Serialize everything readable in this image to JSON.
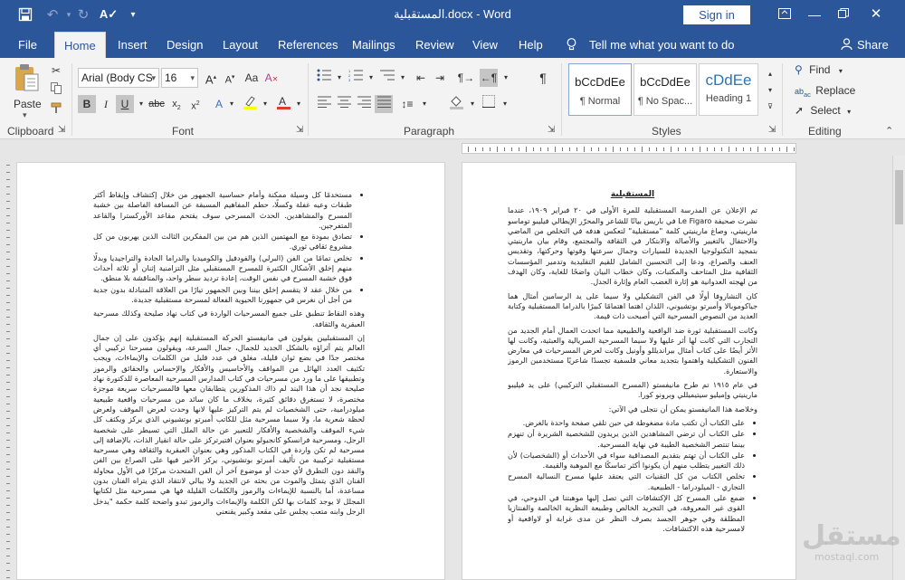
{
  "window": {
    "title": "المستقبلية.docx - Word",
    "sign_in": "Sign in",
    "qat": [
      "save-icon",
      "undo-icon",
      "redo-icon",
      "spelling-icon",
      "customize-icon"
    ]
  },
  "ribbon_tabs": [
    "File",
    "Home",
    "Insert",
    "Design",
    "Layout",
    "References",
    "Mailings",
    "Review",
    "View",
    "Help"
  ],
  "tell_me": "Tell me what you want to do",
  "share": "Share",
  "clipboard": {
    "paste": "Paste",
    "label": "Clipboard"
  },
  "font": {
    "name": "Arial (Body CS",
    "size": "16",
    "label": "Font"
  },
  "paragraph": {
    "label": "Paragraph"
  },
  "styles": {
    "label": "Styles",
    "items": [
      {
        "preview": "bCcDdEe",
        "name": "¶ Normal"
      },
      {
        "preview": "bCcDdEe",
        "name": "¶ No Spac..."
      },
      {
        "preview": "cDdEe",
        "name": "Heading 1"
      }
    ]
  },
  "editing": {
    "label": "Editing",
    "find": "Find",
    "replace": "Replace",
    "select": "Select"
  },
  "document": {
    "right_page": {
      "title": "المستقبلية",
      "paragraphs": [
        "تم الإعلان عن المدرسة المستقبلية للمرة الأولى في ٢٠ فبراير ١٩٠٩، عندما نشرت صحيفة Le Figaro في باريس بيانًا للشاعر والمحرّر الإيطالي فيليبو توماسو مارينيتي، وصاغ مارينيتي كلمة \"مستقبلية\" لتعكس هدفه في التخلص من الماضي والاحتفال بالتغيير والأصالة والابتكار في الثقافة والمجتمع، وقام بيان مارينيتي بتمجيد التكنولوجيا الجديدة للسيارات وجمال سرعتها وقوتها وحركتها، وتقديس العنف والصراع، ودعا إلى التحسين الشامل للقيم التقليدية وتدمير المؤسسات الثقافية مثل المتاحف والمكتبات، وكان خطاب البيان واضحًا للغاية، وكان الهدف من لهجته العدوانية هو إثارة الغضب العام وإثارة الجدل.",
        "كان التشاروفا أولًا في الفن التشكيلي ولا سيما على يد الرسامين أمثال هما جياكوموبالا وأمبرتو بوتشيوني، اللذان اهتما اهتمامًا كبيرًا بالدراما المستقبلية وكتابة العديد من النصوص المسرحية التي أصبحت ذات قيمة.",
        "وكانت المستقبلية ثورة ضد الواقعية والطبيعية مما اتحدت العمال أمام الجديد من التجارب التي كانت لها أثر عليها ولا سيما المسرحية السريالية والعبثية، وكانت لها الأثر أيضًا على كتاب أمثال بيرانديللو وأونيل وكانت لعرض المسرحيات في معارض الفنون التشكيلية واهتموا بتجديد معاني فلسفية تجسدًا شاعريًا مستخدمين الرموز والاستعارة.",
        "في عام ١٩١٥ تم طرح مانيفستو (المسرح المستقبلي التركيبي) على يد فيليبو مارينيتي وإميليو سيتيميللي وبرونو كورا.",
        "وخلاصة هذا المانيفستو يمكن أن نتجلى في الآتي:"
      ],
      "bullets": [
        "على الكتاب أن تكتب مادة مضغوطة في حين تلقي صفحة واحدة بالغرض.",
        "على الكتاب أن ترضي المشاهدين الذين يريدون للشخصية الشريرة أن تنهزم بينما تنتصر الشخصية الطيبة في نهاية المسرحية.",
        "على الكتاب أن تهتم بتقديم المصداقية سواء في الأحداث أو (الشخصيات) لأن ذلك التغيير يتطلب منهم أن يكونوا أكثر تماسكًا مع الموهبة والقيمة.",
        "تخلص الكتاب من كل التقنيات التي يعتقد عليها مسرح النسالية المسرح التجاري - الميلودراما - الطبيعية.",
        "ضمع على المسرح كل الإكتشافات التي تصل إليها موهبتنا في الدوحي، في القوى غير المعروفة، في التجريد الخالص وطبيعة النظرية الخالصة والفنتازيا المطلقة وفي جوهر الجسد بصرف النظر عن مدى غرابة أو لاواقعية أو لامسرحية هذه الاكتشافات."
      ]
    },
    "left_page": {
      "bullets": [
        "مستخدمًا كل وسيلة ممكنة وأمام حساسية الجمهور من خلال إكتشاف وإيقاظ أكثر طبقات وعيه غفلة وكسلًا، حطم المفاهيم المسبقة عن المسافة الفاصلة بين خشبة المسرح والمشاهدين. الحدث المسرحي سوف يقتحم مقاعد الأوركسترا والقاعد المتفرجين.",
        "تصادق بمودة مع المهتمين الذين هم من بين المفكرين الثالث الذين يهربون من كل مشروع ثقافي ثوري.",
        "تخلص تمامًا من الفن (البرلي) والفودفيل والكوميديا والدراما الجادة والتراجيديا وبدلًا منهم إخلق الأشكال الكثيرة للمسرح المستقبلي مثل التزامنية إثنان أو ثلاثة أحداث فوق خشبة المسرح في نفس الوقت، إعادة ترديد سطر واحد، والمناقشة بلا منطق.",
        "من خلال عقد لا يتقسم إخلق بيننا وبين الجمهور تيارًا من العلاقة المتبادلة بدون جدية من أجل أن نغرس في جمهورنا الحيوية الفعالة لمسرحة مستقبلية جديدة."
      ],
      "paragraphs": [
        "وهذه النقاط تنطبق على جميع المسرحيات الواردة في كتاب نهاد صليحة وكذلك مسرحية العبقرية والثقافة.",
        "إن المستقبليين يقولون في مانيفستو الحركة المستقبلية إنهم يؤكدون على إن جمال العالم يتم أثراؤه بالشكل الجديد للجمال، جمال السرعة، ويقولون مسرحنا تركيبي أي مختصر جدًا في بضع ثوان قليلة، مغلق في عدد قليل من الكلمات والإيماءات، ويجب تكثيف العدد الهائل من المواقف والأحاسيس والأفكار والإحساس والحقائق والرموز وتطبيقها على ما ورد من مسرحيات في كتاب المدارس المسرحية المعاصرة للدكتورة نهاد صليحة نجد أن هذا البند لم ذاك المذكورين يتطابقان معها فالمسرحيات سريعة موجزة مختصرة، لا تستغرق دقائق كثيرة، بخلاف ما كان سائد من مسرحيات واقعية طبيعية ميلودرامية، حتى الشخصيات لم يتم التركيز عليها لانها وحدت لعرض الموقف ولعرض لحظة شعرية ما، ولا سيما مسرحية مثل للكاتب أمبرتو بوتشيوني الذي يركز ويكثف كل شيء الموقف والشخصية والأفكار للتعبير عن حالة الملل التي تسيطر على شخصية الرجل، ومسرحية فرانسكو كانجيولو بعنوان افتيرتركز على حالة انقيار الذات، بالإضافة إلى مسرحية لم تكن واردة في الكتاب المذكور وهي بعنوان العبقرية والثقافة وهي مسرحية مستقبلية تركيبية من تأليف أمبرتو بوتشيوني، يركز الأخير فيها على الصراع بين الفن والنقد دون التطرق لأي حدث أو موضوع آخر أن الفن المتحدث مركزًا في الأول محاولة الفنان الذي يتمثل والموت من بحثه عن الجديد ولا يبالي لانتقاد الذي يتراه الفنان بدون مساعدة، أما بالنسبة للإيماءات والرموز والكلمات القليلة فها هي مسرحية مثل لكتابها المجلل لا يوجد كلمات بها لكن الكلمة والإيماءات والرموز تبدو واضحة كلمة حكمة \"يدخل الرجل وابنه متعب يجلس على مقعد وكبير يقنعني"
      ]
    }
  },
  "watermark": {
    "text": "مستقل",
    "sub": "mostaql.com"
  }
}
